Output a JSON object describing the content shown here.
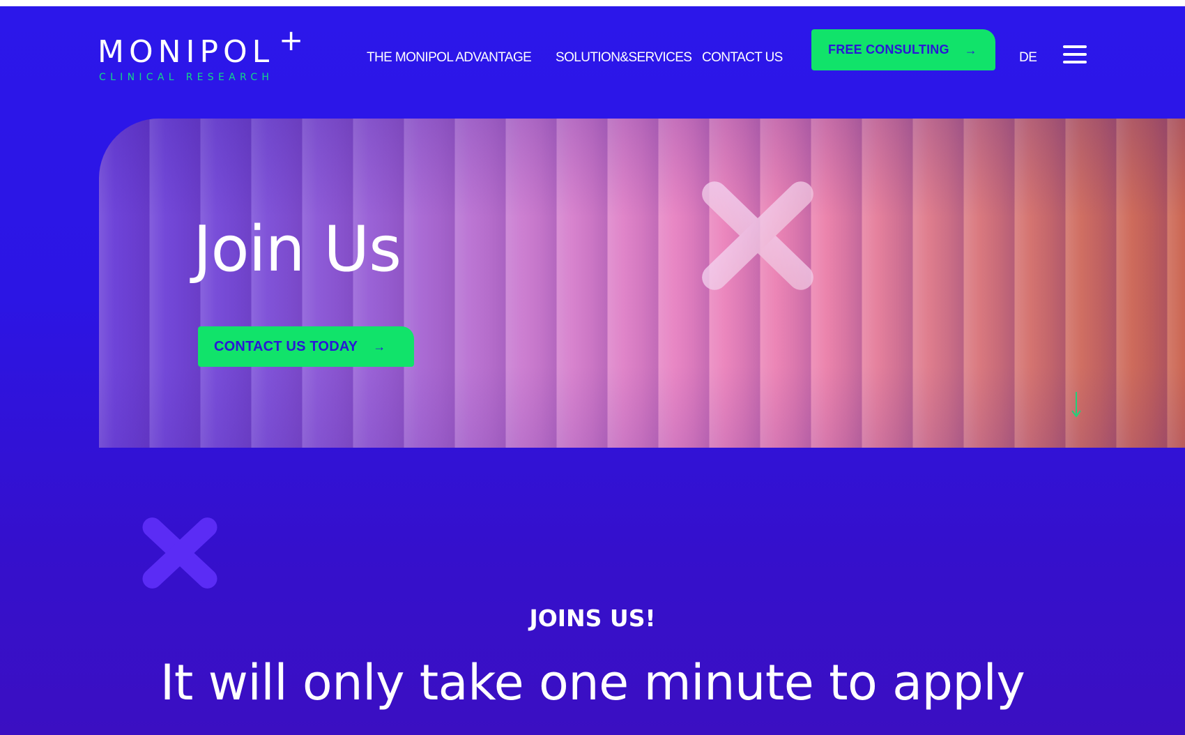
{
  "brand": {
    "name": "MONIPOL",
    "plus": "+",
    "tagline": "CLINICAL RESEARCH"
  },
  "nav": {
    "items": [
      "THE MONIPOL ADVANTAGE",
      "SOLUTION&SERVICES",
      "CONTACT US"
    ],
    "cta": "FREE CONSULTING",
    "language": "DE",
    "menu_icon": "hamburger-icon"
  },
  "hero": {
    "title": "Join Us",
    "cta": "CONTACT US TODAY",
    "decor_icon": "x-cross-icon",
    "scroll_icon": "arrow-down-icon"
  },
  "section": {
    "eyebrow": "JOINS US!",
    "headline": "It will only take one minute to apply"
  },
  "icons": {
    "arrow": "→"
  },
  "colors": {
    "background": "#2c17ea",
    "accent_green": "#11e36a",
    "button_text": "#2a16d6",
    "deco_purple": "#5b2cf5",
    "tagline_green": "#12d987"
  }
}
